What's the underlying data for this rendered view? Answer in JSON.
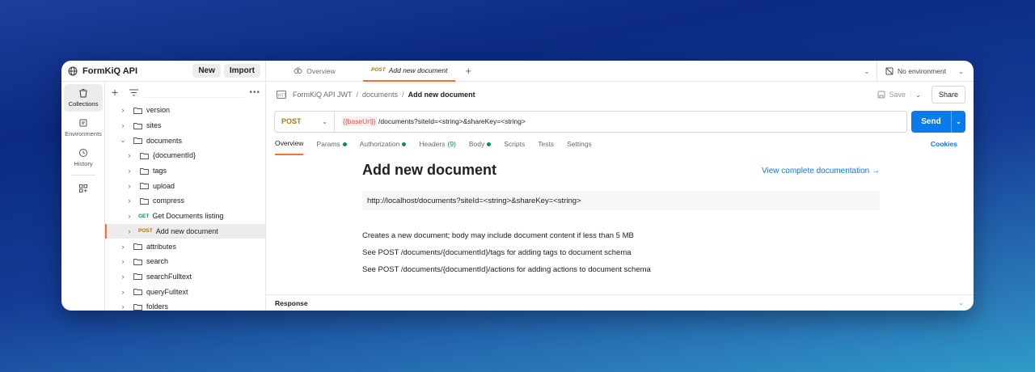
{
  "workspace": {
    "title": "FormKiQ API",
    "new_label": "New",
    "import_label": "Import"
  },
  "rail": [
    {
      "label": "Collections",
      "icon": "trash-can-collections-icon"
    },
    {
      "label": "Environments",
      "icon": "environment-icon"
    },
    {
      "label": "History",
      "icon": "history-icon"
    }
  ],
  "tree": [
    {
      "label": "version",
      "type": "folder",
      "expanded": false,
      "depth": 0
    },
    {
      "label": "sites",
      "type": "folder",
      "expanded": false,
      "depth": 0
    },
    {
      "label": "documents",
      "type": "folder",
      "expanded": true,
      "depth": 0
    },
    {
      "label": "{documentId}",
      "type": "folder",
      "expanded": false,
      "depth": 1
    },
    {
      "label": "tags",
      "type": "folder",
      "expanded": false,
      "depth": 1
    },
    {
      "label": "upload",
      "type": "folder",
      "expanded": false,
      "depth": 1
    },
    {
      "label": "compress",
      "type": "folder",
      "expanded": false,
      "depth": 1
    },
    {
      "label": "Get Documents listing",
      "type": "request",
      "method": "GET",
      "depth": 1
    },
    {
      "label": "Add new document",
      "type": "request",
      "method": "POST",
      "depth": 1,
      "active": true
    },
    {
      "label": "attributes",
      "type": "folder",
      "expanded": false,
      "depth": 0
    },
    {
      "label": "search",
      "type": "folder",
      "expanded": false,
      "depth": 0
    },
    {
      "label": "searchFulltext",
      "type": "folder",
      "expanded": false,
      "depth": 0
    },
    {
      "label": "queryFulltext",
      "type": "folder",
      "expanded": false,
      "depth": 0
    },
    {
      "label": "folders",
      "type": "folder",
      "expanded": false,
      "depth": 0
    }
  ],
  "tabs": {
    "overview": "Overview",
    "active_method": "POST",
    "active_name": "Add new document",
    "environment": "No environment"
  },
  "breadcrumb": {
    "collection": "FormKiQ API JWT",
    "folder": "documents",
    "current": "Add new document"
  },
  "actions": {
    "save": "Save",
    "share": "Share",
    "send": "Send"
  },
  "request": {
    "method": "POST",
    "url_var": "{{baseUrl}}",
    "url_path": "/documents?siteId=<string>&shareKey=<string>"
  },
  "request_tabs": [
    {
      "label": "Overview",
      "active": true
    },
    {
      "label": "Params",
      "dot": true
    },
    {
      "label": "Authorization",
      "dot": true
    },
    {
      "label": "Headers",
      "count": "(9)"
    },
    {
      "label": "Body",
      "dot": true
    },
    {
      "label": "Scripts"
    },
    {
      "label": "Tests"
    },
    {
      "label": "Settings"
    }
  ],
  "cookies_label": "Cookies",
  "doc": {
    "title": "Add new document",
    "link": "View complete documentation →",
    "url": "http://localhost/documents?siteId=<string>&shareKey=<string>",
    "lines": [
      "Creates a new document; body may include document content if less than 5 MB",
      "See POST /documents/{documentId}/tags for adding tags to document schema",
      "See POST /documents/{documentId}/actions for adding actions to document schema"
    ]
  },
  "response_label": "Response",
  "colors": {
    "accent": "#ff6c37",
    "send": "#097bed",
    "post": "#ad7a03",
    "get": "#0c8f55"
  }
}
